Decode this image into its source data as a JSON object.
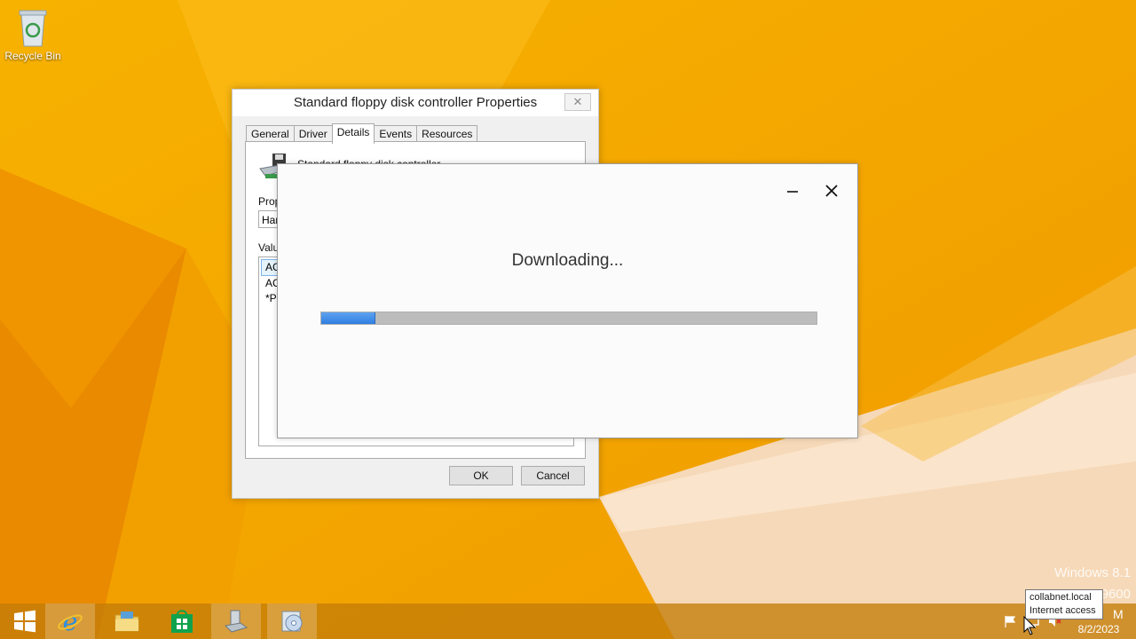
{
  "desktop": {
    "recycle_bin_label": "Recycle Bin"
  },
  "properties_dialog": {
    "title": "Standard floppy disk controller Properties",
    "close_glyph": "✕",
    "tabs": [
      "General",
      "Driver",
      "Details",
      "Events",
      "Resources"
    ],
    "active_tab": "Details",
    "device_name": "Standard floppy disk controller",
    "property_label": "Prop",
    "property_value": "Har",
    "value_label": "Valu",
    "values": [
      "AC",
      "AC",
      "*PN"
    ],
    "ok_label": "OK",
    "cancel_label": "Cancel"
  },
  "download_dialog": {
    "status_text": "Downloading...",
    "progress_fraction": 0.107
  },
  "watermark": {
    "line1": "Windows 8.1",
    "line2": "9600"
  },
  "taskbar": {
    "apps": [
      {
        "name": "start-button",
        "icon": "windows-logo-icon"
      },
      {
        "name": "internet-explorer",
        "icon": "internet-explorer-icon"
      },
      {
        "name": "file-explorer",
        "icon": "folder-icon"
      },
      {
        "name": "store",
        "icon": "store-icon"
      },
      {
        "name": "device-manager",
        "icon": "computer-tools-icon"
      },
      {
        "name": "setup",
        "icon": "disc-setup-icon"
      }
    ],
    "tooltip_line1": "collabnet.local",
    "tooltip_line2": "Internet access",
    "time_fragment": "M",
    "date": "8/2/2023"
  },
  "colors": {
    "wallpaper": "#f5a900",
    "progress_fill": "#3c8ae8",
    "progress_track": "#bcbcbc"
  }
}
